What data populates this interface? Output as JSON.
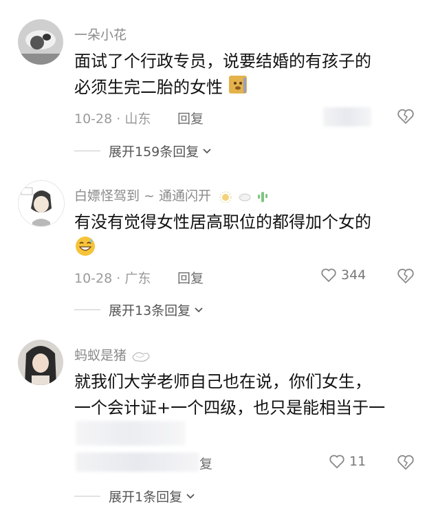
{
  "comments": [
    {
      "username": "一朵小花",
      "text_line1": "面试了个行政专员，说要结婚的有孩子的",
      "text_line2": "必须生完二胎的女性",
      "date_location": "10-28 · 山东",
      "reply_label": "回复",
      "likes": "",
      "expand_label": "展开159条回复",
      "emoji": "doge-emoji"
    },
    {
      "username": "白嫖怪驾到 ~ 通通闪开",
      "text_line1": "有没有觉得女性居高职位的都得加个女的",
      "text_line2": "",
      "date_location": "10-28 · 广东",
      "reply_label": "回复",
      "likes": "344",
      "expand_label": "展开13条回复",
      "emoji": "laugh-sweat-emoji"
    },
    {
      "username": "蚂蚁是猪",
      "text_line1": "就我们大学老师自己也在说，你们女生，",
      "text_line2": "一个会计证+一个四级，也只是能相当于一",
      "date_location": "",
      "reply_label": "回复",
      "reply_partial": "复",
      "likes": "11",
      "expand_label": "展开1条回复"
    }
  ],
  "colors": {
    "meta": "#9a9a9a",
    "text": "#111111",
    "emoji_yellow": "#f6c43a"
  }
}
